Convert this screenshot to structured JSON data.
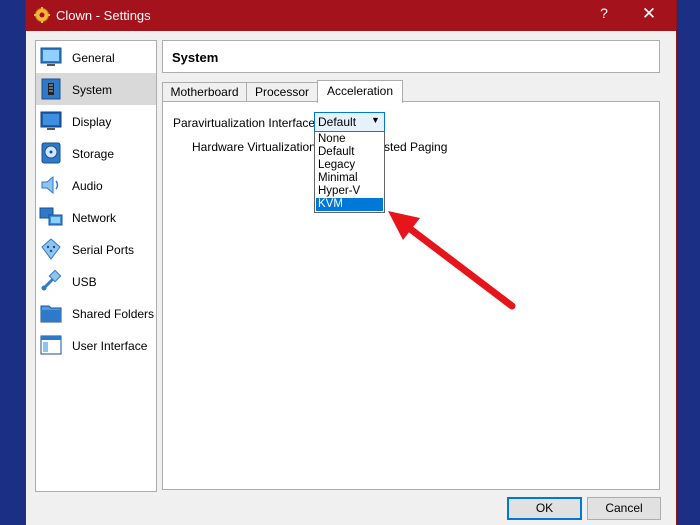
{
  "window": {
    "title": "Clown - Settings",
    "help_glyph": "?",
    "close_glyph": "✕"
  },
  "sidebar": {
    "items": [
      {
        "label": "General",
        "icon": "general-icon"
      },
      {
        "label": "System",
        "icon": "system-icon",
        "selected": true
      },
      {
        "label": "Display",
        "icon": "display-icon"
      },
      {
        "label": "Storage",
        "icon": "storage-icon"
      },
      {
        "label": "Audio",
        "icon": "audio-icon"
      },
      {
        "label": "Network",
        "icon": "network-icon"
      },
      {
        "label": "Serial Ports",
        "icon": "serial-ports-icon"
      },
      {
        "label": "USB",
        "icon": "usb-icon"
      },
      {
        "label": "Shared Folders",
        "icon": "shared-folders-icon"
      },
      {
        "label": "User Interface",
        "icon": "user-interface-icon"
      }
    ]
  },
  "section": {
    "title": "System"
  },
  "tabs": [
    {
      "label": "Motherboard"
    },
    {
      "label": "Processor"
    },
    {
      "label": "Acceleration",
      "active": true
    }
  ],
  "acceleration": {
    "paravirt_label": "Paravirtualization Interface:",
    "paravirt_value": "Default",
    "hw_virt_label": "Hardware Virtualization:",
    "hw_virt_partial": "sted Paging",
    "dropdown_options": [
      "None",
      "Default",
      "Legacy",
      "Minimal",
      "Hyper-V",
      "KVM"
    ],
    "highlighted_option": "KVM"
  },
  "buttons": {
    "ok": "OK",
    "cancel": "Cancel"
  },
  "colors": {
    "titlebar": "#a4121c",
    "accent": "#0078d7",
    "annotation_arrow": "#e8141b",
    "desktop": "#1b2f84"
  }
}
